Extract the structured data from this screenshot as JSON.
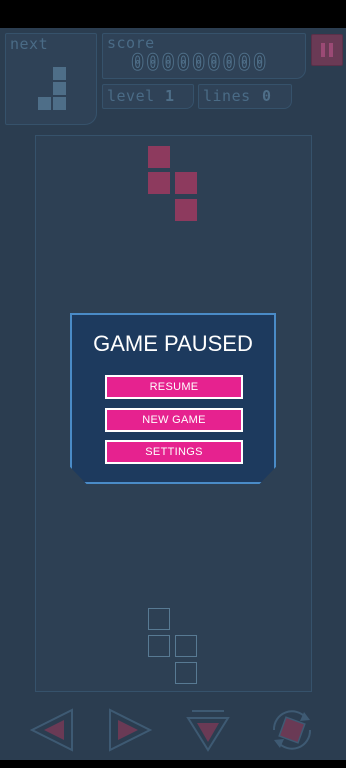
{
  "hud": {
    "next_label": "next",
    "score_label": "score",
    "score_value": "000000000",
    "level_label": "level",
    "level_value": "1",
    "lines_label": "lines",
    "lines_value": "0"
  },
  "dialog": {
    "title": "GAME PAUSED",
    "resume_label": "RESUME",
    "new_game_label": "NEW GAME",
    "settings_label": "SETTINGS"
  },
  "controls": {
    "left": "move-left-icon",
    "right": "move-right-icon",
    "drop": "drop-icon",
    "rotate": "rotate-icon",
    "pause": "pause-icon"
  },
  "colors": {
    "accent": "#e6228f",
    "dialog_bg": "#1d3a5e",
    "dialog_border": "#4a8bc7",
    "board_bg": "#2d4054",
    "piece": "#8d3a5e"
  }
}
